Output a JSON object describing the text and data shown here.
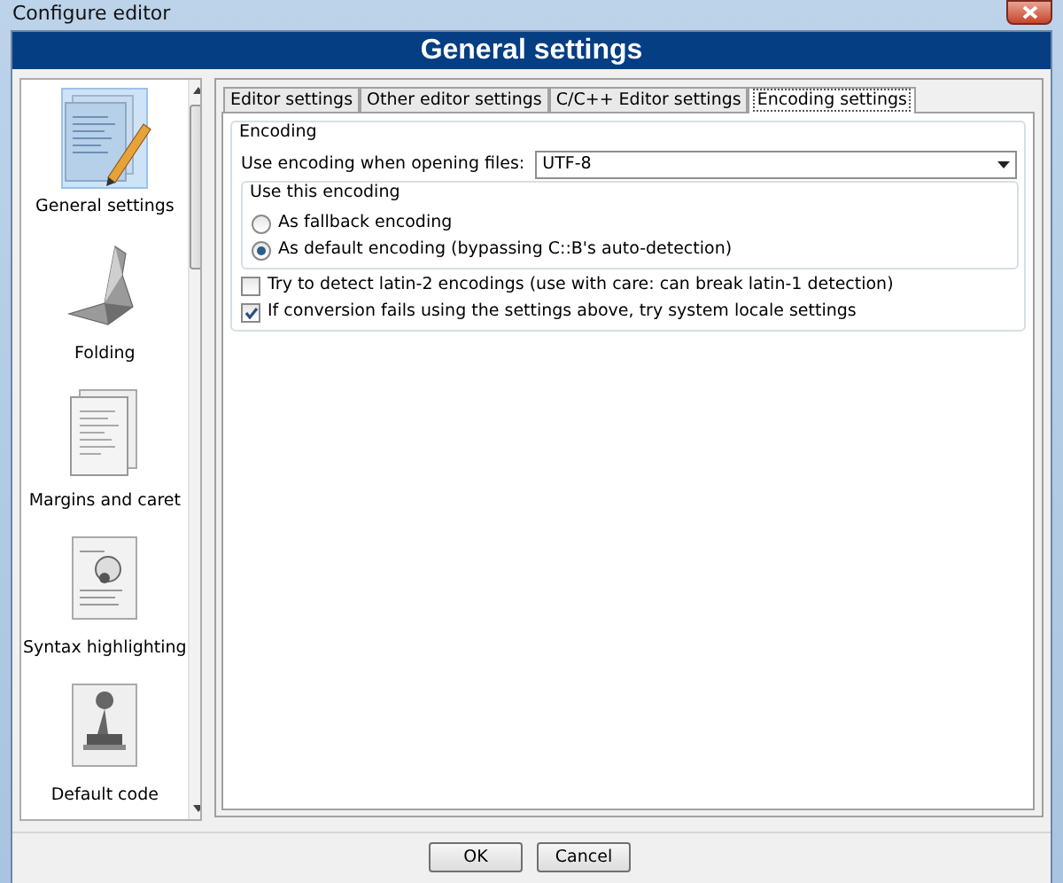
{
  "window": {
    "title": "Configure editor"
  },
  "header": {
    "title": "General settings"
  },
  "sidebar": {
    "items": [
      {
        "label": "General settings",
        "selected": true
      },
      {
        "label": "Folding",
        "selected": false
      },
      {
        "label": "Margins and caret",
        "selected": false
      },
      {
        "label": "Syntax highlighting",
        "selected": false
      },
      {
        "label": "Default code",
        "selected": false
      }
    ]
  },
  "tabs": [
    {
      "label": "Editor settings",
      "selected": false
    },
    {
      "label": "Other editor settings",
      "selected": false
    },
    {
      "label": "C/C++ Editor settings",
      "selected": false
    },
    {
      "label": "Encoding settings",
      "selected": true
    }
  ],
  "encoding": {
    "title": "Encoding",
    "field": {
      "label": "Use encoding when opening files:",
      "value": "UTF-8"
    },
    "use_group": {
      "title": "Use this encoding",
      "options": [
        {
          "label": "As fallback encoding",
          "selected": false
        },
        {
          "label": "As default encoding (bypassing C::B's auto-detection)",
          "selected": true
        }
      ]
    },
    "checkboxes": [
      {
        "label": "Try to detect latin-2 encodings (use with care: can break latin-1 detection)",
        "checked": false
      },
      {
        "label": "If conversion fails using the settings above, try system locale settings",
        "checked": true
      }
    ]
  },
  "buttons": [
    "OK",
    "Cancel"
  ]
}
